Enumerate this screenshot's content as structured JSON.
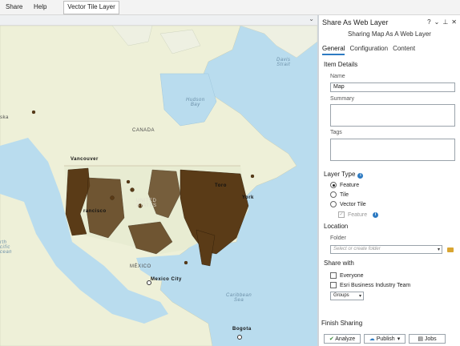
{
  "menu": {
    "share": "Share",
    "help": "Help",
    "context_tab": "Vector Tile Layer"
  },
  "map": {
    "labels": {
      "canada": "CANADA",
      "hudson_bay": "Hudson\nBay",
      "davis_strait": "Davis\nStrait",
      "mexico": "MÉXICO",
      "caribbean_sea": "Caribbean\nSea",
      "alaska": "ska",
      "ocean_left": "rth\ncific\ncean",
      "united_states": "UNITED\nSTATES"
    },
    "cities": {
      "vancouver": "Vancouver",
      "toronto": "Toro",
      "new_york": "York",
      "san_francisco": "rancisco",
      "mexico_city": "Mexico City",
      "bogota": "Bogota"
    }
  },
  "pane": {
    "title": "Share As Web Layer",
    "controls": {
      "help": "?",
      "menu": "⌄",
      "pin": "⊥",
      "close": "✕"
    },
    "subtitle": "Sharing Map As A Web Layer",
    "tabs": [
      "General",
      "Configuration",
      "Content"
    ],
    "item_details": {
      "heading": "Item Details",
      "name_label": "Name",
      "name_value": "Map",
      "summary_label": "Summary",
      "tags_label": "Tags"
    },
    "layer_type": {
      "heading": "Layer Type",
      "options": [
        "Feature",
        "Tile",
        "Vector Tile"
      ],
      "selected": "Feature",
      "sub_feature": "Feature"
    },
    "location": {
      "heading": "Location",
      "folder_label": "Folder",
      "folder_placeholder": "Select or create folder"
    },
    "share_with": {
      "heading": "Share with",
      "everyone": "Everyone",
      "org": "Esri Business Industry Team",
      "groups": "Groups"
    },
    "finish": {
      "heading": "Finish Sharing",
      "analyze": "Analyze",
      "publish": "Publish",
      "jobs": "Jobs"
    }
  },
  "colors": {
    "accent": "#2d7ac2",
    "water": "#b9dcee",
    "land": "#eef0d8",
    "points": "#5a3b17"
  }
}
